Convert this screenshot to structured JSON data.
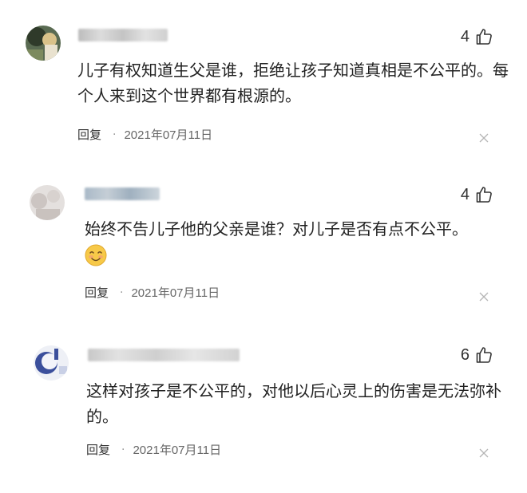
{
  "comments": [
    {
      "likes": "4",
      "text": "儿子有权知道生父是谁，拒绝让孩子知道真相是不公平的。每个人来到这个世界都有根源的。",
      "reply_label": "回复",
      "separator": "·",
      "date": "2021年07月11日"
    },
    {
      "likes": "4",
      "text": "始终不告儿子他的父亲是谁？对儿子是否有点不公平。",
      "reply_label": "回复",
      "separator": "·",
      "date": "2021年07月11日",
      "emoji": "smile-emoji-icon"
    },
    {
      "likes": "6",
      "text": "这样对孩子是不公平的，对他以后心灵上的伤害是无法弥补的。",
      "reply_label": "回复",
      "separator": "·",
      "date": "2021年07月11日"
    }
  ],
  "icons": {
    "like": "thumbs-up-icon",
    "close": "close-icon",
    "emoji": "smile-emoji-icon"
  },
  "colors": {
    "text": "#222222",
    "meta": "#666666",
    "separator": "#999999"
  }
}
